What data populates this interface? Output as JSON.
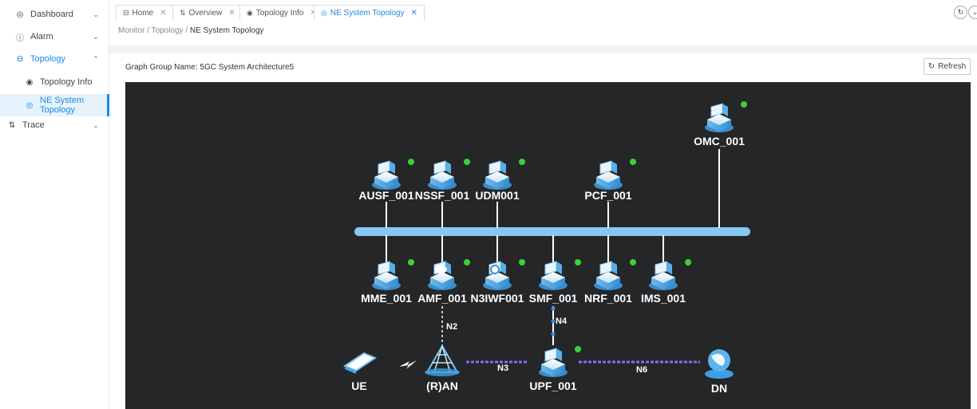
{
  "sidebar": {
    "items": [
      {
        "label": "Dashboard",
        "icon": "eye-icon",
        "glyph": "◎",
        "chevron": "⌄"
      },
      {
        "label": "Alarm",
        "icon": "info-icon",
        "glyph": "ⓘ",
        "chevron": "⌄"
      },
      {
        "label": "Topology",
        "icon": "topology-icon",
        "glyph": "ϴ",
        "chevron": "⌃"
      },
      {
        "label": "Topology Info",
        "icon": "target-icon",
        "glyph": "◉"
      },
      {
        "label": "NE System Topology",
        "icon": "eye-icon",
        "glyph": "◎"
      },
      {
        "label": "Trace",
        "icon": "trace-icon",
        "glyph": "⇅",
        "chevron": "⌄"
      }
    ]
  },
  "tabs": [
    {
      "label": "Home",
      "glyph": "⊟",
      "close": "✕"
    },
    {
      "label": "Overview",
      "glyph": "⇅",
      "close": "✕"
    },
    {
      "label": "Topology Info",
      "glyph": "◉",
      "close": "✕"
    },
    {
      "label": "NE System Topology",
      "glyph": "◎",
      "close": "✕"
    }
  ],
  "breadcrumb": {
    "root": "Monitor",
    "sep": "/",
    "mid": "Topology",
    "current": "NE System Topology"
  },
  "graph": {
    "group_label": "Graph Group Name:",
    "group_name": "5GC System Architecture5",
    "refresh_label": "Refresh",
    "status_color": "#3ad13a",
    "bus_color": "#86c8f2"
  },
  "nodes": [
    {
      "id": "OMC_001",
      "label": "OMC_001",
      "icon": "server-rack-icon"
    },
    {
      "id": "AUSF_001",
      "label": "AUSF_001",
      "icon": "security-server-icon"
    },
    {
      "id": "NSSF_001",
      "label": "NSSF_001",
      "icon": "stack-server-icon"
    },
    {
      "id": "UDM001",
      "label": "UDM001",
      "icon": "database-server-icon"
    },
    {
      "id": "PCF_001",
      "label": "PCF_001",
      "icon": "policy-server-icon"
    },
    {
      "id": "MME_001",
      "label": "MME_001",
      "icon": "mme-server-icon"
    },
    {
      "id": "AMF_001",
      "label": "AMF_001",
      "icon": "cloud-server-icon"
    },
    {
      "id": "N3IWF001",
      "label": "N3IWF001",
      "icon": "disk-server-icon"
    },
    {
      "id": "SMF_001",
      "label": "SMF_001",
      "icon": "stack-server-icon"
    },
    {
      "id": "NRF_001",
      "label": "NRF_001",
      "icon": "repository-icon"
    },
    {
      "id": "IMS_001",
      "label": "IMS_001",
      "icon": "ims-server-icon"
    },
    {
      "id": "UE",
      "label": "UE",
      "icon": "device-icon"
    },
    {
      "id": "RAN",
      "label": "(R)AN",
      "icon": "antenna-tower-icon"
    },
    {
      "id": "UPF_001",
      "label": "UPF_001",
      "icon": "upf-server-icon"
    },
    {
      "id": "DN",
      "label": "DN",
      "icon": "globe-icon"
    }
  ],
  "links": [
    {
      "label": "N2"
    },
    {
      "label": "N4"
    },
    {
      "label": "N3"
    },
    {
      "label": "N6"
    }
  ]
}
